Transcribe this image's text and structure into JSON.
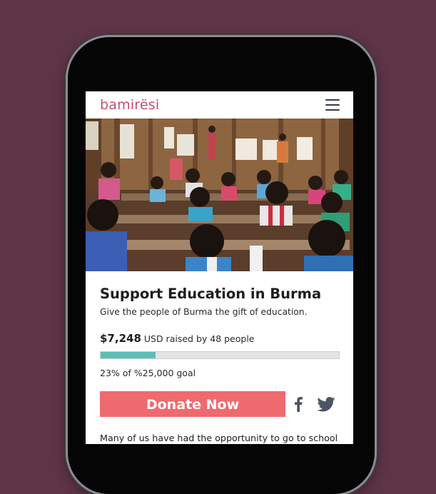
{
  "brand": {
    "name": "bamirësi",
    "color": "#c4526b"
  },
  "header": {
    "menu_icon": "hamburger-menu-icon"
  },
  "hero": {
    "alt_subject": "classroom-photo"
  },
  "campaign": {
    "title": "Support Education in Burma",
    "subtitle": "Give the people of Burma the gift of education.",
    "amount": "$7,248",
    "raised_text": "USD raised by 48 people",
    "progress_fraction": 0.23,
    "goal_text": "23% of %25,000 goal",
    "donate_label": "Donate Now",
    "description_start": "Many of us have had the opportunity to go to school"
  },
  "share": {
    "facebook_icon": "facebook-icon",
    "twitter_icon": "twitter-icon"
  },
  "colors": {
    "background": "#5e3447",
    "donate": "#ef6a6e",
    "progress": "#5bbfb6"
  }
}
